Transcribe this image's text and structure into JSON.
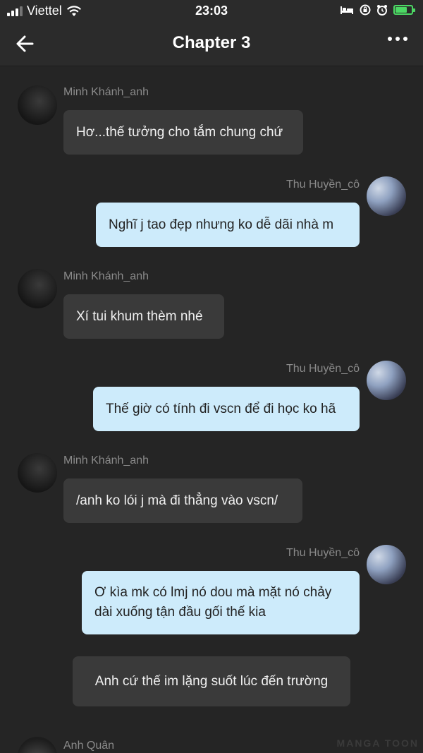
{
  "status_bar": {
    "carrier": "Viettel",
    "time": "23:03"
  },
  "nav": {
    "title": "Chapter 3"
  },
  "messages": [
    {
      "side": "left",
      "sender": "Minh Khánh_anh",
      "text": "Hơ...thế tưởng cho tắm chung chứ"
    },
    {
      "side": "right",
      "sender": "Thu Huyền_cô",
      "text": "Nghĩ j tao đẹp nhưng ko dễ dãi nhà m"
    },
    {
      "side": "left",
      "sender": "Minh Khánh_anh",
      "text": "Xí tui khum thèm nhé"
    },
    {
      "side": "right",
      "sender": "Thu Huyền_cô",
      "text": "Thế giờ có tính đi vscn để đi học ko hã"
    },
    {
      "side": "left",
      "sender": "Minh Khánh_anh",
      "text": "/anh ko lói j mà đi thẳng vào vscn/"
    },
    {
      "side": "right",
      "sender": "Thu Huyền_cô",
      "text": "Ơ kìa mk có lmj nó dou mà mặt nó chảy dài xuống tận đầu gối thế kia"
    },
    {
      "side": "center",
      "sender": "",
      "text": "Anh cứ thế im lặng suốt lúc đến trường"
    },
    {
      "side": "left",
      "sender": "Anh Quân",
      "text": ""
    }
  ],
  "watermark": "MANGA TOON"
}
